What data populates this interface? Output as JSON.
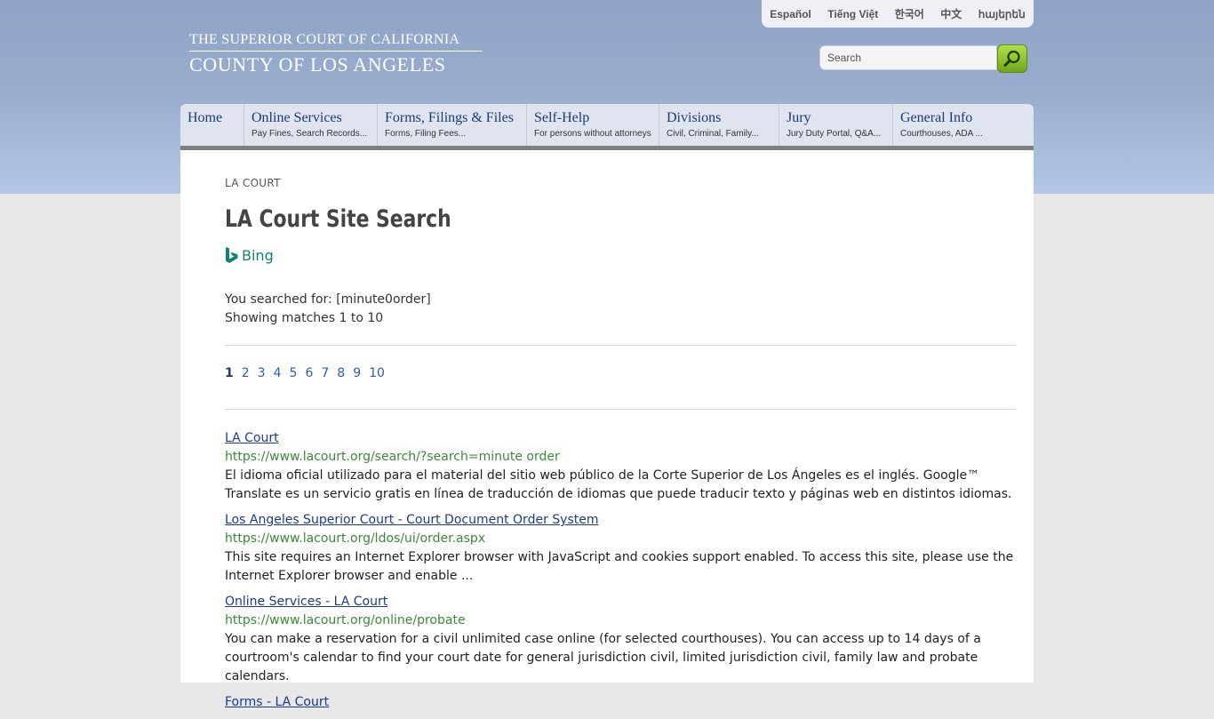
{
  "languages": [
    "Español",
    "Tiếng Việt",
    "한국어",
    "中文",
    "հայերեն"
  ],
  "logo": {
    "line1": "THE SUPERIOR COURT OF CALIFORNIA",
    "line2": "COUNTY OF LOS ANGELES"
  },
  "search": {
    "placeholder": "Search"
  },
  "nav": [
    {
      "title": "Home",
      "sub": ""
    },
    {
      "title": "Online Services",
      "sub": "Pay Fines, Search Records..."
    },
    {
      "title": "Forms, Filings & Files",
      "sub": "Forms, Filing Fees..."
    },
    {
      "title": "Self-Help",
      "sub": "For persons without attorneys"
    },
    {
      "title": "Divisions",
      "sub": "Civil, Criminal, Family..."
    },
    {
      "title": "Jury",
      "sub": "Jury Duty Portal, Q&A..."
    },
    {
      "title": "General Info",
      "sub": "Courthouses, ADA ..."
    }
  ],
  "breadcrumb": "LA COURT",
  "page_title": "LA Court Site Search",
  "bing_label": "Bing",
  "searched_for": "You searched for: [minute0order]",
  "showing": "Showing matches 1 to 10",
  "pages": [
    "1",
    "2",
    "3",
    "4",
    "5",
    "6",
    "7",
    "8",
    "9",
    "10"
  ],
  "results": [
    {
      "title": "LA Court",
      "url": "https://www.lacourt.org/search/?search=minute order",
      "desc": "El idioma oficial utilizado para el material del sitio web público de la Corte Superior de Los Ángeles es el inglés. Google™ Translate es un servicio gratis en línea de traducción de idiomas que puede traducir texto y páginas web en distintos idiomas."
    },
    {
      "title": "Los Angeles Superior Court - Court Document Order System",
      "url": "https://www.lacourt.org/ldos/ui/order.aspx",
      "desc": "This site requires an Internet Explorer browser with JavaScript and cookies support enabled. To access this site, please use the Internet Explorer browser and enable ..."
    },
    {
      "title": "Online Services - LA Court",
      "url": "https://www.lacourt.org/online/probate",
      "desc": "You can make a reservation for a civil unlimited case online (for selected courthouses). You can access up to 14 days of a courtroom's calendar to find your court date for general jurisdiction civil, limited jurisdiction civil, family law and probate calendars."
    },
    {
      "title": "Forms - LA Court",
      "url": "",
      "desc": ""
    }
  ]
}
